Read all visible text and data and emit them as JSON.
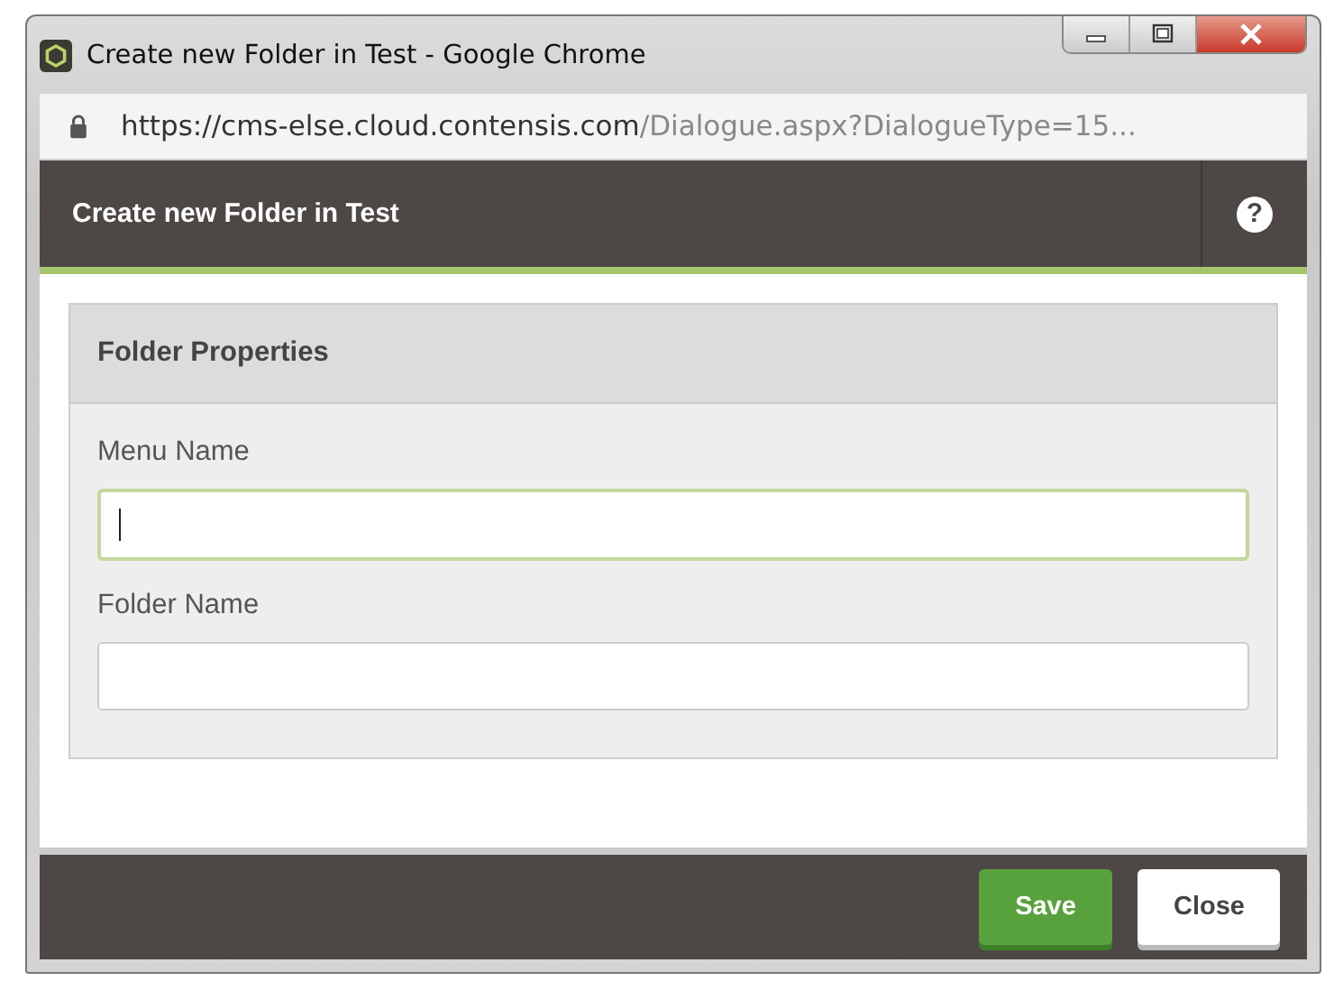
{
  "window": {
    "title": "Create new Folder in Test - Google Chrome"
  },
  "address_bar": {
    "host": "https://cms-else.cloud.contensis.com",
    "path": "/Dialogue.aspx?DialogueType=15..."
  },
  "dialog": {
    "title": "Create new Folder in Test",
    "help": "?"
  },
  "panel": {
    "title": "Folder Properties",
    "fields": [
      {
        "label": "Menu Name",
        "focused": true
      },
      {
        "label": "Folder Name",
        "focused": false
      }
    ]
  },
  "buttons": [
    {
      "label": "Save",
      "kind": "primary"
    },
    {
      "label": "Close",
      "kind": "secondary"
    }
  ]
}
